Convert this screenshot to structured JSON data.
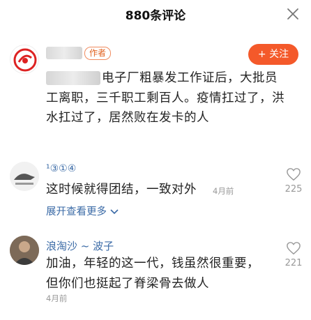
{
  "header": {
    "title": "880条评论"
  },
  "comments": [
    {
      "author_tag": "作者",
      "follow_label": "+ 关注",
      "text": "电子厂粗暴发工作证后，大批员工离职，三千职工剩百人。疫情扛过了，洪水扛过了，居然败在发卡的人"
    },
    {
      "username": "¹③①④",
      "text": "这时候就得团结，一致对外",
      "time": "4月前",
      "likes": "225",
      "expand_label": "展开查看更多"
    },
    {
      "username": "浪淘沙 ~ 波子",
      "text": "加油，年轻的这一代，钱虽然很重要，但你们也挺起了脊梁骨去做人",
      "time": "4月前",
      "likes": "221"
    }
  ],
  "icons": {
    "close": "close-icon",
    "like": "heart-outline-icon",
    "expand": "chevron-down-icon"
  },
  "colors": {
    "accent": "#f4592a",
    "link": "#3a6aa6"
  }
}
